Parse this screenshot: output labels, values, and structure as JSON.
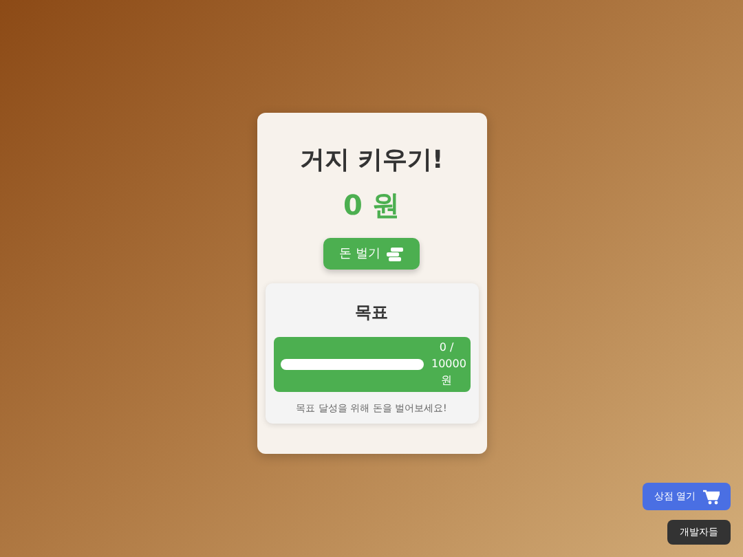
{
  "title": "거지 키우기!",
  "money": "0 원",
  "earn_button": {
    "label": "돈 벌기"
  },
  "goal": {
    "title": "목표",
    "level": 0,
    "reading": "0 / 10000 원",
    "message": "목표 달성을 위해 돈을 벌어보세요!"
  },
  "shop_button": {
    "label": "상점 열기"
  },
  "developers_button": {
    "label": "개발자들"
  }
}
